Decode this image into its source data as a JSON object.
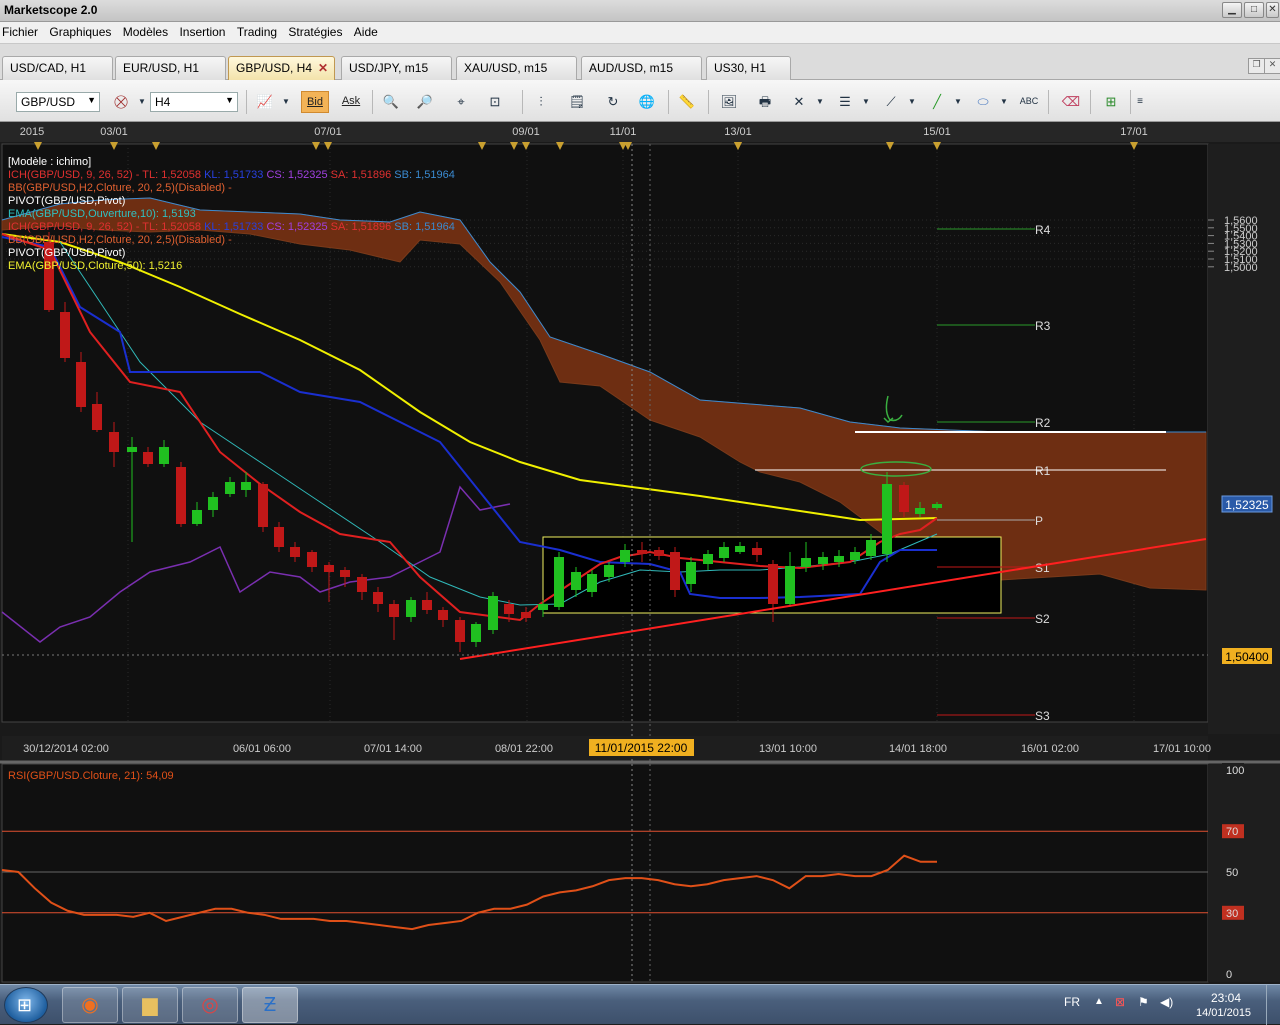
{
  "window": {
    "title": "Marketscope 2.0"
  },
  "menu": [
    "Fichier",
    "Graphiques",
    "Modèles",
    "Insertion",
    "Trading",
    "Stratégies",
    "Aide"
  ],
  "tabs": [
    {
      "label": "USD/CAD, H1"
    },
    {
      "label": "EUR/USD, H1"
    },
    {
      "label": "GBP/USD, H4",
      "active": true
    },
    {
      "label": "USD/JPY, m15"
    },
    {
      "label": "XAU/USD, m15"
    },
    {
      "label": "AUD/USD, m15"
    },
    {
      "label": "US30, H1"
    }
  ],
  "toolbar": {
    "symbol": "GBP/USD",
    "timeframe": "H4",
    "bid_label": "Bid",
    "ask_label": "Ask"
  },
  "chart": {
    "top_dates": [
      "2015",
      "03/01",
      "07/01",
      "09/01",
      "11/01",
      "13/01",
      "15/01",
      "17/01"
    ],
    "legend": [
      {
        "text": "[Modèle : ichimo]",
        "color": "#ffffff"
      },
      {
        "parts": [
          {
            "t": "ICH(GBP/USD, 9, 26, 52) -  TL: 1,52058 ",
            "c": "#e03030"
          },
          {
            "t": " KL: 1,51733 ",
            "c": "#2840e0"
          },
          {
            "t": " CS: 1,52325 ",
            "c": "#a040e0"
          },
          {
            "t": " SA: 1,51896 ",
            "c": "#e03030"
          },
          {
            "t": " SB: 1,51964",
            "c": "#3a8ad0"
          }
        ]
      },
      {
        "text": "BB(GBP/USD,H2,Cloture, 20, 2,5)(Disabled) -",
        "color": "#e06030"
      },
      {
        "text": "PIVOT(GBP/USD,Pivot)",
        "color": "#ffffff"
      },
      {
        "text": "EMA(GBP/USD,Ouverture,10): 1,5193",
        "color": "#30c0c0"
      },
      {
        "parts": [
          {
            "t": "ICH(GBP/USD, 9, 26, 52) -  TL: 1,52058 ",
            "c": "#e03030"
          },
          {
            "t": " KL: 1,51733 ",
            "c": "#2840e0"
          },
          {
            "t": " CS: 1,52325 ",
            "c": "#a040e0"
          },
          {
            "t": " SA: 1,51896 ",
            "c": "#e03030"
          },
          {
            "t": " SB: 1,51964",
            "c": "#3a8ad0"
          }
        ]
      },
      {
        "text": "BB(GBP/USD,H2,Cloture, 20, 2,5)(Disabled) -",
        "color": "#e06030"
      },
      {
        "text": "PIVOT(GBP/USD,Pivot)",
        "color": "#ffffff"
      },
      {
        "text": "EMA(GBP/USD,Cloture,50): 1,5216",
        "color": "#f0f030"
      }
    ],
    "y_axis": [
      "1,5600",
      "1,5500",
      "1,5400",
      "1,5300",
      "1,5200",
      "1,5100",
      "1,5000"
    ],
    "current_price": "1,52325",
    "crosshair_price": "1,50400",
    "pivots": [
      "R4",
      "R3",
      "R2",
      "R1",
      "P",
      "S1",
      "S2",
      "S3"
    ],
    "bottom_dates": [
      "30/12/2014 02:00",
      "06/01 06:00",
      "07/01 14:00",
      "08/01 22:00",
      "13/01 10:00",
      "14/01 18:00",
      "16/01 02:00",
      "17/01 10:00"
    ],
    "crosshair_date": "11/01/2015 22:00"
  },
  "rsi": {
    "legend": "RSI(GBP/USD.Cloture, 21): 54,09",
    "levels": [
      "100",
      "70",
      "50",
      "30",
      "0"
    ],
    "values": [
      51,
      50,
      42,
      35,
      31,
      29,
      29,
      29,
      28,
      30,
      26,
      28,
      30,
      32,
      32,
      30,
      29,
      27,
      27,
      27,
      26,
      26,
      25,
      24,
      23,
      22,
      24,
      25,
      26,
      30,
      32,
      32,
      34,
      38,
      40,
      41,
      43,
      46,
      47,
      47,
      46,
      44,
      43,
      44,
      46,
      47,
      48,
      46,
      42,
      48,
      48,
      49,
      48,
      48,
      51,
      58,
      55,
      55
    ]
  },
  "taskbar": {
    "lang": "FR",
    "time": "23:04",
    "date": "14/01/2015"
  },
  "colors": {
    "cloud": "#6e2e12",
    "tenkan": "#e02020",
    "kijun": "#1a2fd0",
    "ema50": "#f0f000",
    "ema10": "#30b8b8",
    "chikou": "#7a2fb0",
    "rsi": "#e05018",
    "bull": "#20c020",
    "bear": "#c01818"
  }
}
